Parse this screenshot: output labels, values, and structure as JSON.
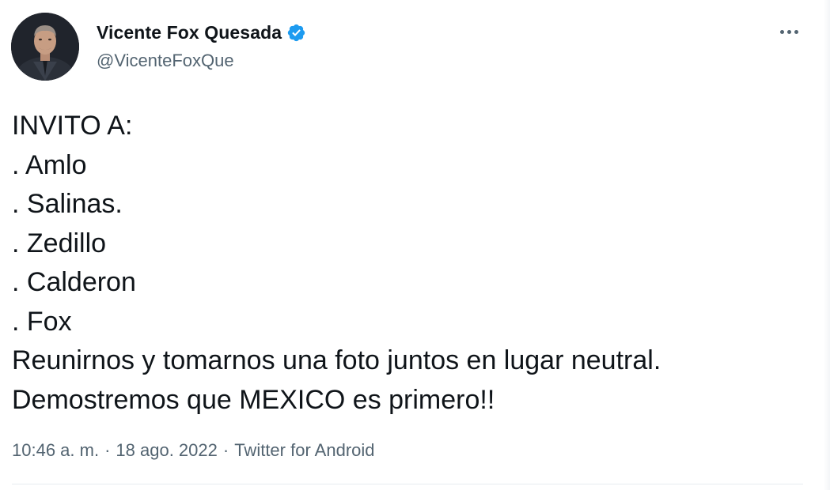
{
  "author": {
    "display_name": "Vicente Fox Quesada",
    "handle": "@VicenteFoxQue",
    "verified": true,
    "avatar_icon": "profile-photo"
  },
  "tweet": {
    "lines": [
      "INVITO A:",
      ". Amlo",
      ". Salinas.",
      ". Zedillo",
      ". Calderon",
      ". Fox",
      "Reunirnos y tomarnos una foto juntos en lugar neutral.",
      "Demostremos que MEXICO es primero!!"
    ]
  },
  "meta": {
    "time": "10:46 a. m.",
    "separator": "·",
    "date": "18 ago. 2022",
    "source": "Twitter for Android"
  },
  "icons": {
    "verified": "verified-badge-icon",
    "more": "more-options-icon"
  },
  "colors": {
    "text_primary": "#0f1419",
    "text_secondary": "#536471",
    "verified_blue": "#1d9bf0"
  }
}
